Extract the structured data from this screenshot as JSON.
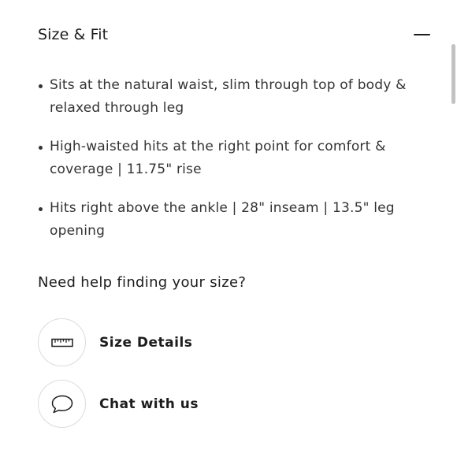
{
  "size_fit": {
    "title": "Size & Fit",
    "toggle_icon": "minus-icon",
    "bullets": [
      "Sits at the natural waist, slim through top of body & relaxed through leg",
      "High-waisted hits at the right point for comfort & coverage | 11.75\" rise",
      "Hits right above the ankle | 28\" inseam | 13.5\" leg opening"
    ]
  },
  "help": {
    "heading": "Need help finding your size?",
    "size_details": {
      "label": "Size Details",
      "icon": "ruler-icon"
    },
    "chat": {
      "label": "Chat with us",
      "icon": "chat-bubble-icon"
    }
  },
  "colors": {
    "text": "#1c1c1c",
    "body_text": "#333333",
    "circle_border": "#dcdcdc",
    "scrollbar": "#c2c2c2"
  }
}
